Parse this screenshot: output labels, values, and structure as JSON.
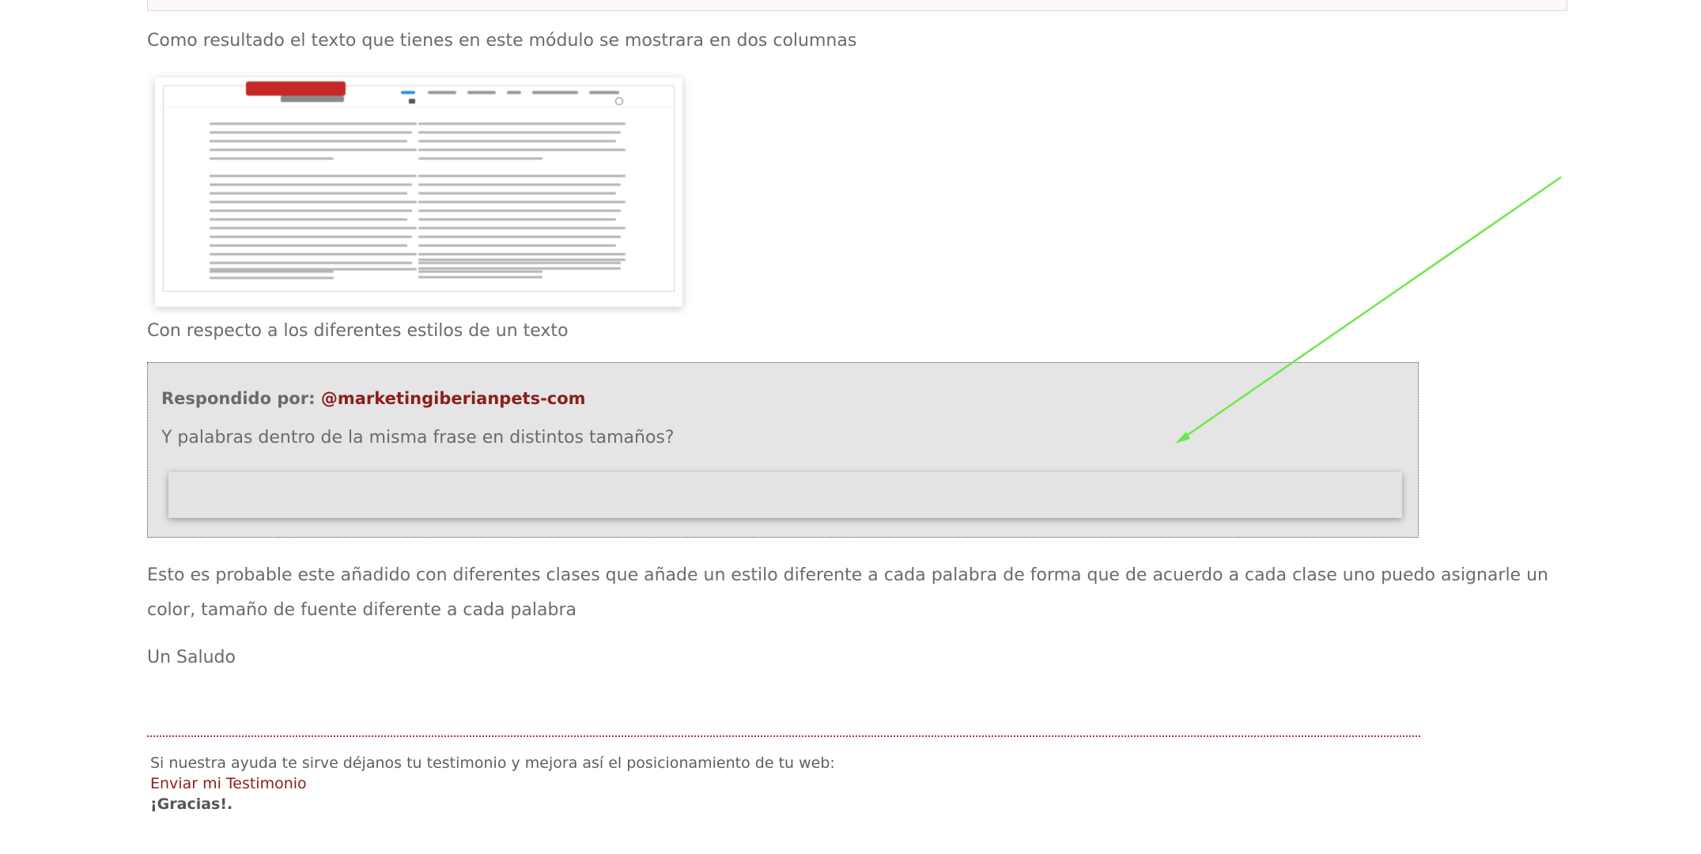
{
  "post": {
    "para1": "Como resultado el texto que tienes en este módulo se mostrara en dos columnas",
    "para2": "Con respecto a los diferentes estilos de un texto",
    "para3": "Esto es probable este añadido con diferentes clases que añade un estilo diferente a cada palabra de forma que de acuerdo a cada clase uno puedo asignarle un color, tamaño de fuente diferente a cada palabra",
    "para4": "Un Saludo"
  },
  "reply": {
    "by_label": "Respondido por:",
    "user": "@marketingiberianpets-com",
    "text": "Y palabras dentro de la misma frase en distintos tamaños?"
  },
  "footer": {
    "text": "Si nuestra ayuda te sirve déjanos tu testimonio y mejora así el posicionamiento de tu web:",
    "link": "Enviar mi Testimonio",
    "thanks": "¡Gracias!."
  },
  "colors": {
    "link": "#8b1e1e",
    "arrow": "#6ee84a",
    "divider": "#b83434"
  }
}
